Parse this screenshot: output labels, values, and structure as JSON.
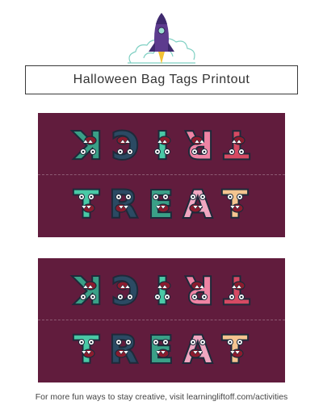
{
  "header": {
    "logo_icon": "rocket-cloud-icon",
    "title": "Halloween Bag Tags Printout"
  },
  "theme": {
    "tag_bg": "#611c3d",
    "letter_colors": [
      "#e9c39b",
      "#d64a63",
      "#ef84a4",
      "#49c9a6",
      "#2b4a63",
      "#3aa087",
      "#f0a7c1",
      "#f4c590"
    ]
  },
  "tags": [
    {
      "top_word": "TRICK",
      "top_flipped": true,
      "bottom_word": "TREAT"
    },
    {
      "top_word": "TRICK",
      "top_flipped": true,
      "bottom_word": "TREAT"
    }
  ],
  "footer": {
    "text": "For more fun ways to stay creative, visit learningliftoff.com/activities"
  }
}
